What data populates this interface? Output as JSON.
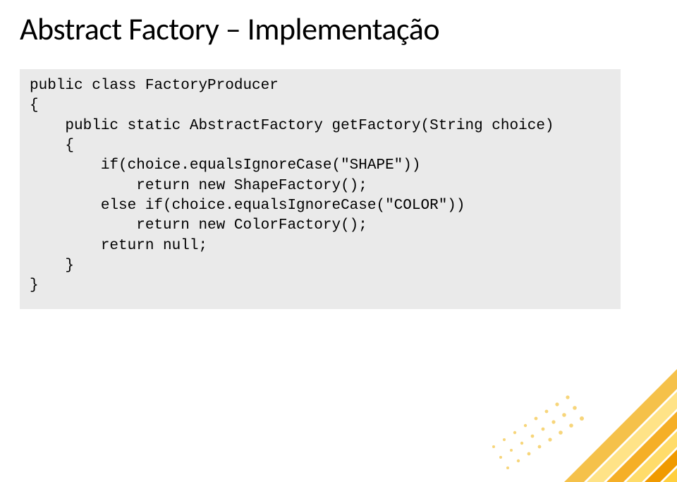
{
  "title": "Abstract Factory – Implementação",
  "code": {
    "l01": "public class FactoryProducer",
    "l02": "{",
    "l03": "    public static AbstractFactory getFactory(String choice)",
    "l04": "    {",
    "l05": "        if(choice.equalsIgnoreCase(\"SHAPE\"))",
    "l06": "            return new ShapeFactory();",
    "l07": "        else if(choice.equalsIgnoreCase(\"COLOR\"))",
    "l08": "            return new ColorFactory();",
    "l09": "        return null;",
    "l10": "    }",
    "l11": "}"
  }
}
